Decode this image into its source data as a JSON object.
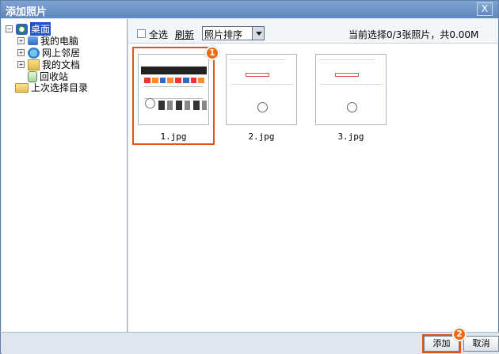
{
  "dialog": {
    "title": "添加照片",
    "close_label": "X"
  },
  "tree": {
    "root": {
      "label": "桌面",
      "expander": "−"
    },
    "items": [
      {
        "label": "我的电脑",
        "expander": "+"
      },
      {
        "label": "网上邻居",
        "expander": "+"
      },
      {
        "label": "我的文档",
        "expander": "+"
      },
      {
        "label": "回收站"
      }
    ],
    "last_dir": {
      "label": "上次选择目录"
    }
  },
  "toolbar": {
    "select_all": "全选",
    "refresh": "刷新",
    "sort_value": "照片排序",
    "status": "当前选择0/3张照片，共0.00M"
  },
  "photos": [
    {
      "filename": "1.jpg"
    },
    {
      "filename": "2.jpg"
    },
    {
      "filename": "3.jpg"
    }
  ],
  "callouts": {
    "step_1": "1",
    "step_2": "2"
  },
  "buttons": {
    "add": "添加",
    "cancel": "取消"
  }
}
